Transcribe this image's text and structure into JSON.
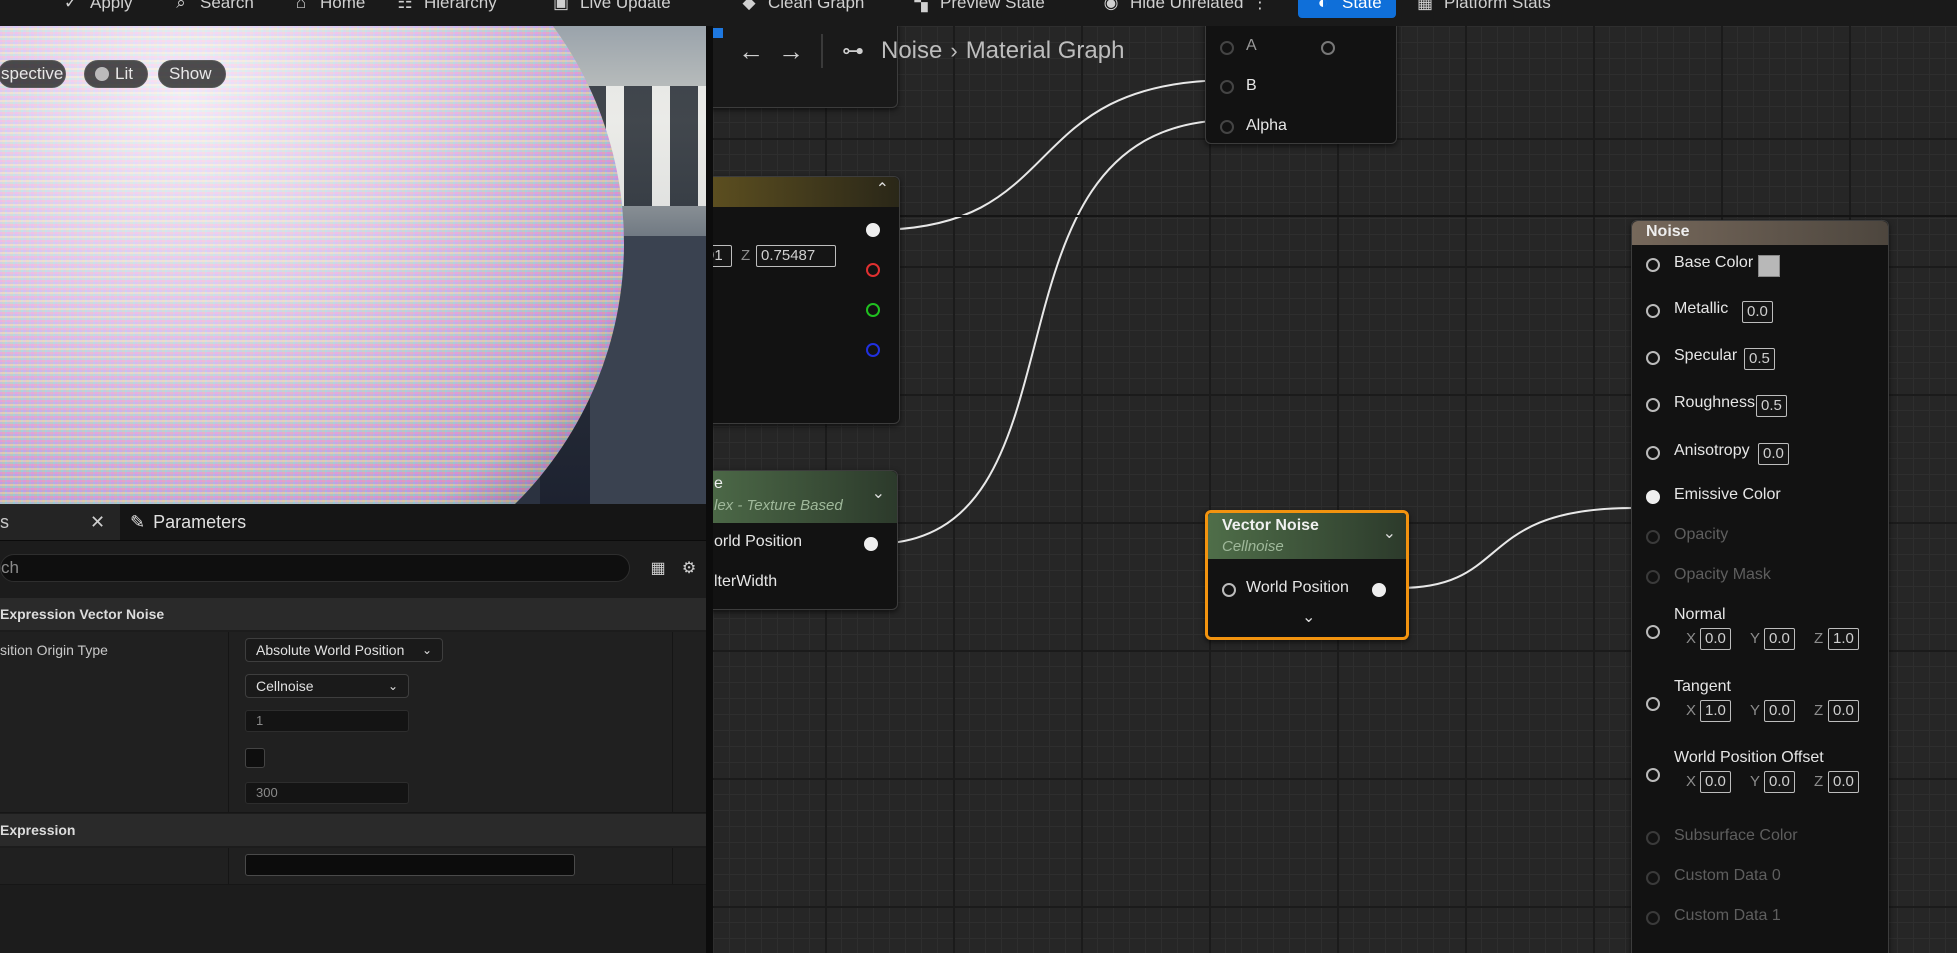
{
  "toolbar": {
    "items": [
      "Apply",
      "Search",
      "Home",
      "Hierarchy",
      "Live Update",
      "Clean Graph",
      "Preview State",
      "Hide Unrelated",
      "State",
      "Platform Stats"
    ]
  },
  "viewport": {
    "view_mode": "spective",
    "lit_label": "Lit",
    "show_label": "Show"
  },
  "details": {
    "tab_label": "Parameters",
    "search_placeholder": "ch",
    "section1": "Expression Vector Noise",
    "rows": [
      {
        "label": "sition Origin Type",
        "value": "Absolute World Position"
      },
      {
        "label": "",
        "value": "Cellnoise"
      },
      {
        "label": "",
        "value": "1"
      },
      {
        "label": "",
        "value": ""
      },
      {
        "label": "",
        "value": "300"
      }
    ],
    "section2": "Expression",
    "desc_value": ""
  },
  "graph": {
    "breadcrumb_root": "Noise",
    "breadcrumb_sep": "›",
    "breadcrumb_leaf": "Material Graph",
    "lerp_node": {
      "pins": [
        "A",
        "B",
        "Alpha"
      ]
    },
    "constant_node": {
      "z_label": "Z",
      "z_value": "0.75487",
      "partial_value": "91"
    },
    "texture_node": {
      "title": "e",
      "subtitle": "lex - Texture Based",
      "pins": [
        "orld Position",
        "lterWidth"
      ]
    },
    "vector_noise": {
      "title": "Vector Noise",
      "subtitle": "Cellnoise",
      "pin": "World Position"
    },
    "material_node": {
      "title": "Noise",
      "pins": [
        {
          "label": "Base Color",
          "type": "color",
          "enabled": true
        },
        {
          "label": "Metallic",
          "value": "0.0",
          "enabled": true
        },
        {
          "label": "Specular",
          "value": "0.5",
          "enabled": true
        },
        {
          "label": "Roughness",
          "value": "0.5",
          "enabled": true
        },
        {
          "label": "Anisotropy",
          "value": "0.0",
          "enabled": true
        },
        {
          "label": "Emissive Color",
          "enabled": true
        },
        {
          "label": "Opacity",
          "enabled": false
        },
        {
          "label": "Opacity Mask",
          "enabled": false
        },
        {
          "label": "Normal",
          "x": "0.0",
          "y": "0.0",
          "z": "1.0",
          "enabled": true
        },
        {
          "label": "Tangent",
          "x": "1.0",
          "y": "0.0",
          "z": "0.0",
          "enabled": true
        },
        {
          "label": "World Position Offset",
          "x": "0.0",
          "y": "0.0",
          "z": "0.0",
          "enabled": true
        },
        {
          "label": "Subsurface Color",
          "enabled": false
        },
        {
          "label": "Custom Data 0",
          "enabled": false
        },
        {
          "label": "Custom Data 1",
          "enabled": false
        }
      ]
    },
    "axis": {
      "x": "X",
      "y": "Y",
      "z": "Z"
    }
  }
}
